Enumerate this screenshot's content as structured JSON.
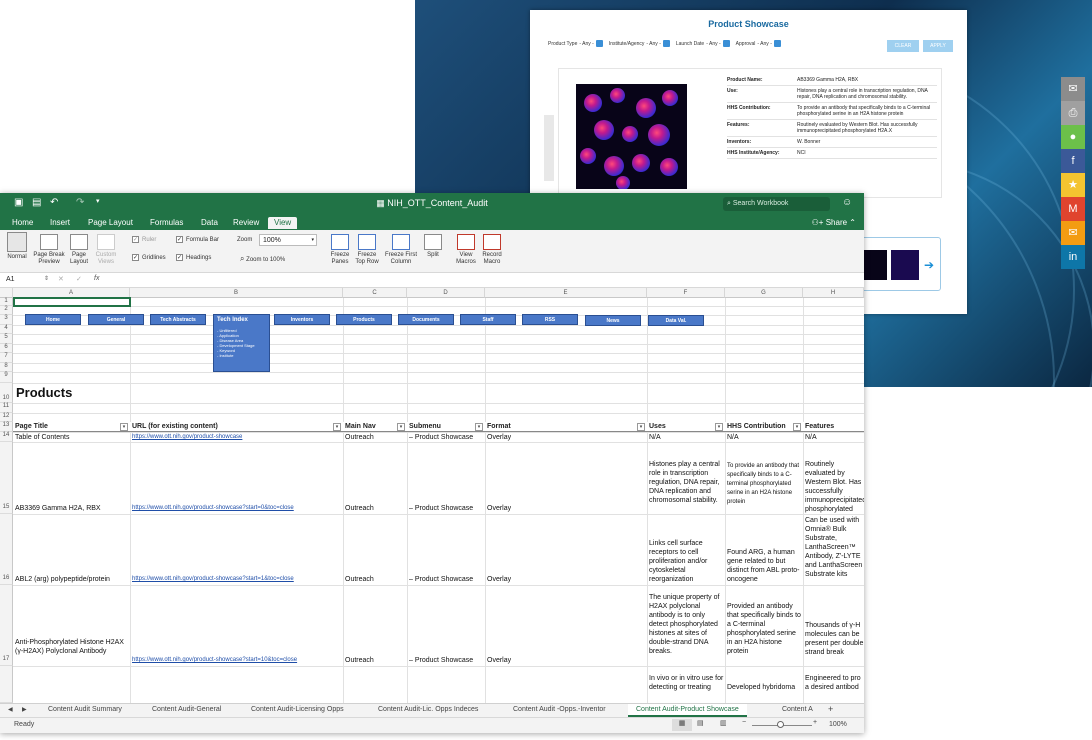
{
  "website": {
    "title": "Product Showcase",
    "filters": [
      {
        "label": "Product Type",
        "value": "- Any -"
      },
      {
        "label": "Institute/Agency",
        "value": "- Any -"
      },
      {
        "label": "Launch Date",
        "value": "- Any -"
      },
      {
        "label": "Approval",
        "value": "- Any -"
      }
    ],
    "clear_label": "CLEAR",
    "apply_label": "APPLY",
    "details": [
      {
        "key": "Product Name:",
        "value": "AB3369 Gamma H2A, RBX"
      },
      {
        "key": "Use:",
        "value": "Histones play a central role in transcription regulation, DNA repair, DNA replication and chromosomal stability."
      },
      {
        "key": "HHS Contribution:",
        "value": "To provide an antibody that specifically binds to a C-terminal phosphorylated serine in an H2A histone protein"
      },
      {
        "key": "Features:",
        "value": "Routinely evaluated by Western Blot. Has successfully immunoprecipitated phosphorylated H2A.X"
      },
      {
        "key": "Inventors:",
        "value": "W. Bonner"
      },
      {
        "key": "HHS Institute/Agency:",
        "value": "NCI"
      }
    ],
    "social": [
      {
        "name": "email-icon",
        "glyph": "✉",
        "color": "#8c8c8c"
      },
      {
        "name": "print-icon",
        "glyph": "⎙",
        "color": "#a0a0a0"
      },
      {
        "name": "chat-icon",
        "glyph": "●",
        "color": "#6cc04a"
      },
      {
        "name": "facebook-icon",
        "glyph": "f",
        "color": "#3b5998"
      },
      {
        "name": "favorite-icon",
        "glyph": "★",
        "color": "#f4c430"
      },
      {
        "name": "gmail-icon",
        "glyph": "M",
        "color": "#e0442e"
      },
      {
        "name": "mail-icon",
        "glyph": "✉",
        "color": "#f39c12"
      },
      {
        "name": "linkedin-icon",
        "glyph": "in",
        "color": "#0e76a8"
      }
    ]
  },
  "excel": {
    "file_name": "NIH_OTT_Content_Audit",
    "search_placeholder": "Search Workbook",
    "tabs": [
      "Home",
      "Insert",
      "Page Layout",
      "Formulas",
      "Data",
      "Review",
      "View"
    ],
    "active_tab": "View",
    "share_label": "Share",
    "ribbon": {
      "normal": "Normal",
      "page_break": "Page Break\nPreview",
      "page_layout": "Page\nLayout",
      "custom_views": "Custom\nViews",
      "ruler": "Ruler",
      "formula_bar": "Formula Bar",
      "gridlines": "Gridlines",
      "headings": "Headings",
      "zoom_label": "Zoom",
      "zoom_value": "100%",
      "zoom_to_100": "Zoom to 100%",
      "freeze_panes": "Freeze\nPanes",
      "freeze_top_row": "Freeze\nTop Row",
      "freeze_first_column": "Freeze First\nColumn",
      "split": "Split",
      "view_macros": "View\nMacros",
      "record_macro": "Record\nMacro"
    },
    "name_box": "A1",
    "fx": "fx",
    "columns": [
      "A",
      "B",
      "C",
      "D",
      "E",
      "F",
      "G",
      "H"
    ],
    "rows": [
      "1",
      "2",
      "3",
      "4",
      "5",
      "6",
      "7",
      "8",
      "9",
      "10",
      "11",
      "12",
      "13",
      "14",
      "15",
      "16",
      "17"
    ],
    "nav_buttons": [
      "Home",
      "General",
      "Tech Abstracts",
      "Inventors",
      "Products",
      "Documents",
      "Staff",
      "RSS",
      "News",
      "Data Val."
    ],
    "tech_index": {
      "title": "Tech Index",
      "items": [
        "- Unfiltered",
        "- Application",
        "- Disease Area",
        "- Development Stage",
        "- Keyword",
        "- Institute"
      ]
    },
    "section_title": "Products",
    "headers": [
      "Page Title",
      "URL (for existing content)",
      "Main Nav",
      "Submenu",
      "Format",
      "Uses",
      "HHS Contribution",
      "Features"
    ],
    "data_rows": [
      {
        "row": "14",
        "title": "Table of Contents",
        "url": "https://www.ott.nih.gov/product-showcase",
        "nav": "Outreach",
        "sub": "– Product Showcase",
        "format": "Overlay",
        "uses": "N/A",
        "hhs": "N/A",
        "features": "N/A"
      },
      {
        "row": "15",
        "title": "AB3369 Gamma H2A, RBX",
        "url": "https://www.ott.nih.gov/product-showcase?start=0&toc=close",
        "nav": "Outreach",
        "sub": "– Product Showcase",
        "format": "Overlay",
        "uses": "Histones play a central role in transcription regulation, DNA repair, DNA replication and chromosomal stability.",
        "hhs": "To provide an antibody that specifically binds to a C-terminal phosphorylated serine in an H2A histone protein",
        "features": "Routinely evaluated by Western Blot. Has successfully immunoprecipitated phosphorylated"
      },
      {
        "row": "16",
        "title": "ABL2 (arg) polypeptide/protein",
        "url": "https://www.ott.nih.gov/product-showcase?start=1&toc=close",
        "nav": "Outreach",
        "sub": "– Product Showcase",
        "format": "Overlay",
        "uses": "Links cell surface receptors to cell proliferation and/or cytoskeletal reorganization",
        "hhs": "Found ARG, a human gene related to but distinct from ABL proto-oncogene",
        "features": "Can be used with Omnia® Bulk Substrate, LanthaScreen™ Antibody, Z'-LYTE and LanthaScreen Substrate kits"
      },
      {
        "row": "17",
        "title": "Anti-Phosphorylated Histone H2AX (γ-H2AX) Polyclonal Antibody",
        "url": "https://www.ott.nih.gov/product-showcase?start=10&toc=close",
        "nav": "Outreach",
        "sub": "– Product Showcase",
        "format": "Overlay",
        "uses": "The unique property of H2AX polyclonal antibody is to only detect phosphorylated histones at sites of double-strand DNA breaks.",
        "hhs": "Provided an antibody that specifically binds to a C-terminal phosphorylated serine in an H2A histone protein",
        "features": "Thousands of γ-H molecules can be present per double strand break"
      },
      {
        "row": "",
        "title": "",
        "url": "",
        "nav": "",
        "sub": "",
        "format": "",
        "uses": "In vivo or in vitro use for detecting or treating",
        "hhs": "Developed hybridoma",
        "features": "Engineered to pro a desired antibod"
      }
    ],
    "sheet_tabs": [
      "Content Audit Summary",
      "Content Audit-General",
      "Content Audit-Licensing Opps",
      "Content Audit-Lic. Opps Indeces",
      "Content Audit -Opps.-Inventor",
      "Content Audit-Product Showcase",
      "Content A"
    ],
    "active_sheet": "Content Audit-Product Showcase",
    "status": "Ready",
    "zoom_status": "100%",
    "accent": "#217346"
  }
}
